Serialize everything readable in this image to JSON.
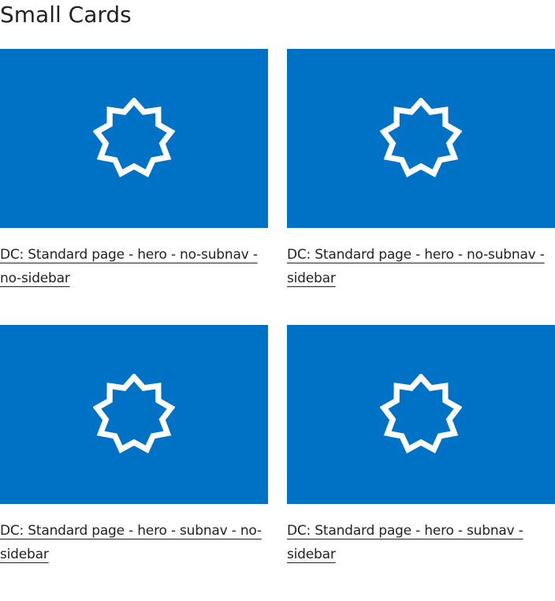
{
  "section": {
    "title": "Small Cards"
  },
  "cards": [
    {
      "title": "DC: Standard page - hero - no-subnav - no-sidebar",
      "icon": "nine-pointed-star-icon"
    },
    {
      "title": "DC: Standard page - hero - no-subnav - sidebar",
      "icon": "nine-pointed-star-icon"
    },
    {
      "title": "DC: Standard page - hero - subnav - no-sidebar",
      "icon": "nine-pointed-star-icon"
    },
    {
      "title": "DC: Standard page - hero - subnav - sidebar",
      "icon": "nine-pointed-star-icon"
    }
  ],
  "colors": {
    "card_background": "#0072c6",
    "icon": "#ffffff",
    "text": "#222222"
  }
}
